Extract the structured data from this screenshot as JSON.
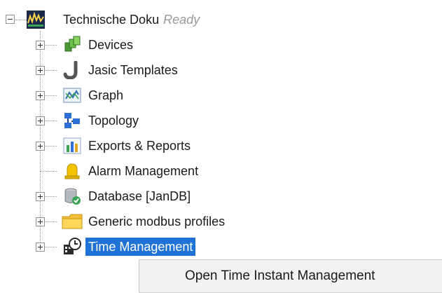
{
  "tree": {
    "root": {
      "label": "Technische Doku",
      "status": "Ready",
      "icon": "app-logo-icon",
      "expanded": true
    },
    "items": [
      {
        "label": "Devices",
        "icon": "devices-icon",
        "has_children": true
      },
      {
        "label": "Jasic Templates",
        "icon": "jasic-j-icon",
        "has_children": true
      },
      {
        "label": "Graph",
        "icon": "graph-icon",
        "has_children": true
      },
      {
        "label": "Topology",
        "icon": "topology-icon",
        "has_children": true
      },
      {
        "label": "Exports & Reports",
        "icon": "bar-chart-icon",
        "has_children": true
      },
      {
        "label": "Alarm Management",
        "icon": "alarm-bell-icon",
        "has_children": false
      },
      {
        "label": "Database [JanDB]",
        "icon": "database-icon",
        "has_children": true
      },
      {
        "label": "Generic modbus profiles",
        "icon": "folder-icon",
        "has_children": true
      },
      {
        "label": "Time Management",
        "icon": "time-management-icon",
        "has_children": true,
        "selected": true
      }
    ]
  },
  "context_menu": {
    "items": [
      {
        "label": "Open Time Instant Management"
      }
    ]
  },
  "colors": {
    "selection": "#1f73d6",
    "status_text": "#9a9a9a",
    "menu_bg": "#f2f2f2"
  }
}
